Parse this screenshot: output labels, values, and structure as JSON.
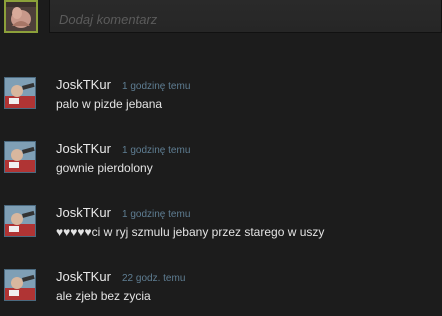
{
  "composer": {
    "placeholder": "Dodaj komentarz"
  },
  "comments": [
    {
      "author": "JoskTKur",
      "time": "1 godzinę temu",
      "text": "palo w pizde jebana"
    },
    {
      "author": "JoskTKur",
      "time": "1 godzinę temu",
      "text": "gownie pierdolony"
    },
    {
      "author": "JoskTKur",
      "time": "1 godzinę temu",
      "text": "♥♥♥♥♥ci w ryj szmulu jebany przez starego w uszy"
    },
    {
      "author": "JoskTKur",
      "time": "22 godz. temu",
      "text": "ale zjeb bez zycia"
    }
  ],
  "colors": {
    "background": "#1c1c1c",
    "author": "#e8e8e8",
    "timestamp": "#5f7e93",
    "text": "#e3e3e3",
    "avatar_border_self": "#8ca03a"
  }
}
